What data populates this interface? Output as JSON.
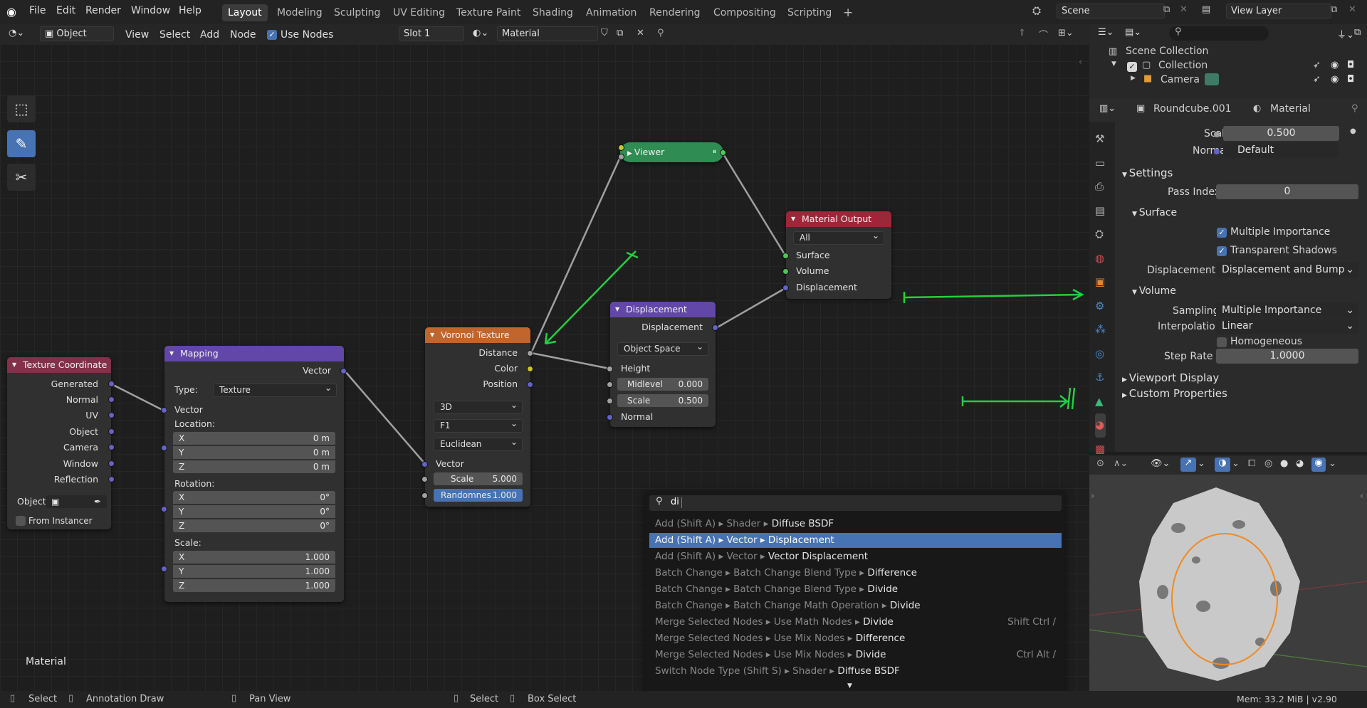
{
  "topbar": {
    "menus": [
      "File",
      "Edit",
      "Render",
      "Window",
      "Help"
    ],
    "workspaces": [
      "Layout",
      "Modeling",
      "Sculpting",
      "UV Editing",
      "Texture Paint",
      "Shading",
      "Animation",
      "Rendering",
      "Compositing",
      "Scripting"
    ],
    "active_workspace": "Layout",
    "plus": "+",
    "scene": "Scene",
    "view_layer": "View Layer"
  },
  "node_header": {
    "mode": "Object",
    "view": "View",
    "select": "Select",
    "add": "Add",
    "node": "Node",
    "use_nodes": "Use Nodes",
    "slot": "Slot 1",
    "material": "Material"
  },
  "canvas": {
    "material_label": "Material"
  },
  "nodes": {
    "texcoord": {
      "title": "Texture Coordinate",
      "outputs": [
        "Generated",
        "Normal",
        "UV",
        "Object",
        "Camera",
        "Window",
        "Reflection"
      ],
      "object_label": "Object",
      "from_instancer": "From Instancer"
    },
    "mapping": {
      "title": "Mapping",
      "out": "Vector",
      "type_label": "Type:",
      "type_value": "Texture",
      "vector": "Vector",
      "location": "Location:",
      "rotation": "Rotation:",
      "scale": "Scale:",
      "loc": [
        {
          "a": "X",
          "v": "0 m"
        },
        {
          "a": "Y",
          "v": "0 m"
        },
        {
          "a": "Z",
          "v": "0 m"
        }
      ],
      "rot": [
        {
          "a": "X",
          "v": "0°"
        },
        {
          "a": "Y",
          "v": "0°"
        },
        {
          "a": "Z",
          "v": "0°"
        }
      ],
      "scl": [
        {
          "a": "X",
          "v": "1.000"
        },
        {
          "a": "Y",
          "v": "1.000"
        },
        {
          "a": "Z",
          "v": "1.000"
        }
      ]
    },
    "voronoi": {
      "title": "Voronoi Texture",
      "outputs": [
        "Distance",
        "Color",
        "Position"
      ],
      "dim": "3D",
      "feature": "F1",
      "metric": "Euclidean",
      "vector": "Vector",
      "scale_label": "Scale",
      "scale": "5.000",
      "rand_label": "Randomnes",
      "rand": "1.000"
    },
    "displacement": {
      "title": "Displacement",
      "out": "Displacement",
      "space": "Object Space",
      "height": "Height",
      "mid_label": "Midlevel",
      "mid": "0.000",
      "scale_label": "Scale",
      "scale": "0.500",
      "normal": "Normal"
    },
    "viewer": {
      "title": "Viewer"
    },
    "matout": {
      "title": "Material Output",
      "target": "All",
      "inputs": [
        "Surface",
        "Volume",
        "Displacement"
      ]
    }
  },
  "search": {
    "query": "di",
    "results": [
      {
        "path": "Add (Shift A) ▸ Shader ▸ ",
        "name": "Diffuse BSDF",
        "shortcut": ""
      },
      {
        "path": "Add (Shift A) ▸ Vector ▸ ",
        "name": "Displacement",
        "shortcut": "",
        "hl": true
      },
      {
        "path": "Add (Shift A) ▸ Vector ▸ ",
        "name": "Vector Displacement",
        "shortcut": ""
      },
      {
        "path": "Batch Change ▸ Batch Change Blend Type ▸ ",
        "name": "Difference",
        "shortcut": ""
      },
      {
        "path": "Batch Change ▸ Batch Change Blend Type ▸ ",
        "name": "Divide",
        "shortcut": ""
      },
      {
        "path": "Batch Change ▸ Batch Change Math Operation ▸ ",
        "name": "Divide",
        "shortcut": ""
      },
      {
        "path": "Merge Selected Nodes ▸ Use Math Nodes ▸ ",
        "name": "Divide",
        "shortcut": "Shift Ctrl /"
      },
      {
        "path": "Merge Selected Nodes ▸ Use Mix Nodes ▸ ",
        "name": "Difference",
        "shortcut": ""
      },
      {
        "path": "Merge Selected Nodes ▸ Use Mix Nodes ▸ ",
        "name": "Divide",
        "shortcut": "Ctrl Alt /"
      },
      {
        "path": "Switch Node Type (Shift S) ▸ Shader ▸ ",
        "name": "Diffuse BSDF",
        "shortcut": ""
      }
    ]
  },
  "outliner": {
    "root": "Scene Collection",
    "collection": "Collection",
    "camera": "Camera"
  },
  "properties": {
    "object": "Roundcube.001",
    "material": "Material",
    "scale_label": "Scale",
    "scale": "0.500",
    "normal_label": "Normal",
    "normal": "Default",
    "settings": "Settings",
    "pass_index_label": "Pass Index",
    "pass_index": "0",
    "surface": "Surface",
    "multi_imp": "Multiple Importance",
    "transp_shadows": "Transparent Shadows",
    "disp_label": "Displacement",
    "disp": "Displacement and Bump",
    "volume": "Volume",
    "sampling_label": "Sampling",
    "sampling": "Multiple Importance",
    "interp_label": "Interpolation",
    "interp": "Linear",
    "homogeneous": "Homogeneous",
    "step_label": "Step Rate",
    "step": "1.0000",
    "viewport_display": "Viewport Display",
    "custom_props": "Custom Properties"
  },
  "status": {
    "select": "Select",
    "annotation": "Annotation Draw",
    "pan": "Pan View",
    "select2": "Select",
    "box": "Box Select",
    "mem": "Mem: 33.2 MiB | v2.90"
  }
}
